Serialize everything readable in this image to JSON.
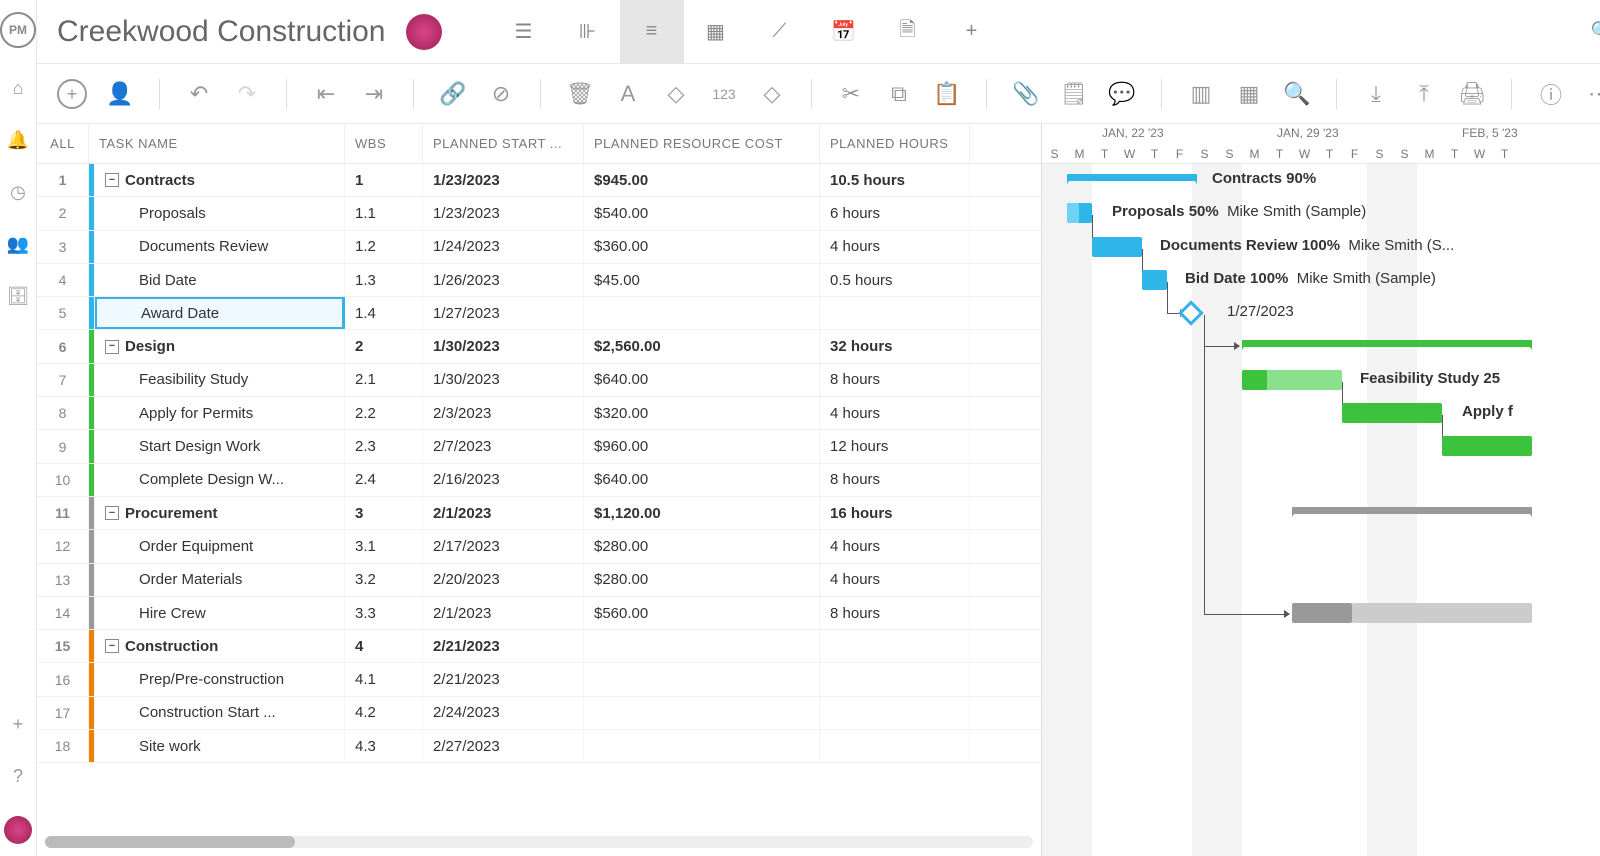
{
  "project_title": "Creekwood Construction",
  "logo_text": "PM",
  "columns": {
    "all": "ALL",
    "name": "TASK NAME",
    "wbs": "WBS",
    "start": "PLANNED START ...",
    "cost": "PLANNED RESOURCE COST",
    "hours": "PLANNED HOURS"
  },
  "timeline": {
    "week1": "JAN, 22 '23",
    "week2": "JAN, 29 '23",
    "week3": "FEB, 5 '23",
    "days": [
      "S",
      "M",
      "T",
      "W",
      "T",
      "F",
      "S",
      "S",
      "M",
      "T",
      "W",
      "T",
      "F",
      "S",
      "S",
      "M",
      "T",
      "W",
      "T"
    ]
  },
  "rows": [
    {
      "n": "1",
      "name": "Contracts",
      "wbs": "1",
      "start": "1/23/2023",
      "cost": "$945.00",
      "hours": "10.5 hours",
      "bold": true,
      "color": "#2eb6e8",
      "level": 0
    },
    {
      "n": "2",
      "name": "Proposals",
      "wbs": "1.1",
      "start": "1/23/2023",
      "cost": "$540.00",
      "hours": "6 hours",
      "color": "#2eb6e8",
      "level": 1
    },
    {
      "n": "3",
      "name": "Documents Review",
      "wbs": "1.2",
      "start": "1/24/2023",
      "cost": "$360.00",
      "hours": "4 hours",
      "color": "#2eb6e8",
      "level": 1
    },
    {
      "n": "4",
      "name": "Bid Date",
      "wbs": "1.3",
      "start": "1/26/2023",
      "cost": "$45.00",
      "hours": "0.5 hours",
      "color": "#2eb6e8",
      "level": 1
    },
    {
      "n": "5",
      "name": "Award Date",
      "wbs": "1.4",
      "start": "1/27/2023",
      "cost": "",
      "hours": "",
      "color": "#2eb6e8",
      "level": 1,
      "selected": true
    },
    {
      "n": "6",
      "name": "Design",
      "wbs": "2",
      "start": "1/30/2023",
      "cost": "$2,560.00",
      "hours": "32 hours",
      "bold": true,
      "color": "#3cc23c",
      "level": 0
    },
    {
      "n": "7",
      "name": "Feasibility Study",
      "wbs": "2.1",
      "start": "1/30/2023",
      "cost": "$640.00",
      "hours": "8 hours",
      "color": "#3cc23c",
      "level": 1
    },
    {
      "n": "8",
      "name": "Apply for Permits",
      "wbs": "2.2",
      "start": "2/3/2023",
      "cost": "$320.00",
      "hours": "4 hours",
      "color": "#3cc23c",
      "level": 1
    },
    {
      "n": "9",
      "name": "Start Design Work",
      "wbs": "2.3",
      "start": "2/7/2023",
      "cost": "$960.00",
      "hours": "12 hours",
      "color": "#3cc23c",
      "level": 1
    },
    {
      "n": "10",
      "name": "Complete Design W...",
      "wbs": "2.4",
      "start": "2/16/2023",
      "cost": "$640.00",
      "hours": "8 hours",
      "color": "#3cc23c",
      "level": 1
    },
    {
      "n": "11",
      "name": "Procurement",
      "wbs": "3",
      "start": "2/1/2023",
      "cost": "$1,120.00",
      "hours": "16 hours",
      "bold": true,
      "color": "#999",
      "level": 0
    },
    {
      "n": "12",
      "name": "Order Equipment",
      "wbs": "3.1",
      "start": "2/17/2023",
      "cost": "$280.00",
      "hours": "4 hours",
      "color": "#999",
      "level": 1
    },
    {
      "n": "13",
      "name": "Order Materials",
      "wbs": "3.2",
      "start": "2/20/2023",
      "cost": "$280.00",
      "hours": "4 hours",
      "color": "#999",
      "level": 1
    },
    {
      "n": "14",
      "name": "Hire Crew",
      "wbs": "3.3",
      "start": "2/1/2023",
      "cost": "$560.00",
      "hours": "8 hours",
      "color": "#999",
      "level": 1
    },
    {
      "n": "15",
      "name": "Construction",
      "wbs": "4",
      "start": "2/21/2023",
      "cost": "",
      "hours": "",
      "bold": true,
      "color": "#f08000",
      "level": 0
    },
    {
      "n": "16",
      "name": "Prep/Pre-construction",
      "wbs": "4.1",
      "start": "2/21/2023",
      "cost": "",
      "hours": "",
      "color": "#f08000",
      "level": 1
    },
    {
      "n": "17",
      "name": "Construction Start ...",
      "wbs": "4.2",
      "start": "2/24/2023",
      "cost": "",
      "hours": "",
      "color": "#f08000",
      "level": 1
    },
    {
      "n": "18",
      "name": "Site work",
      "wbs": "4.3",
      "start": "2/27/2023",
      "cost": "",
      "hours": "",
      "color": "#f08000",
      "level": 1
    }
  ],
  "gantt_labels": {
    "r0": "Contracts  90%",
    "r1a": "Proposals  50%",
    "r1b": "Mike Smith (Sample)",
    "r2a": "Documents Review  100%",
    "r2b": "Mike Smith (S...",
    "r3a": "Bid Date  100%",
    "r3b": "Mike Smith (Sample)",
    "r4": "1/27/2023",
    "r6a": "Feasibility Study  25",
    "r7a": "Apply f"
  }
}
